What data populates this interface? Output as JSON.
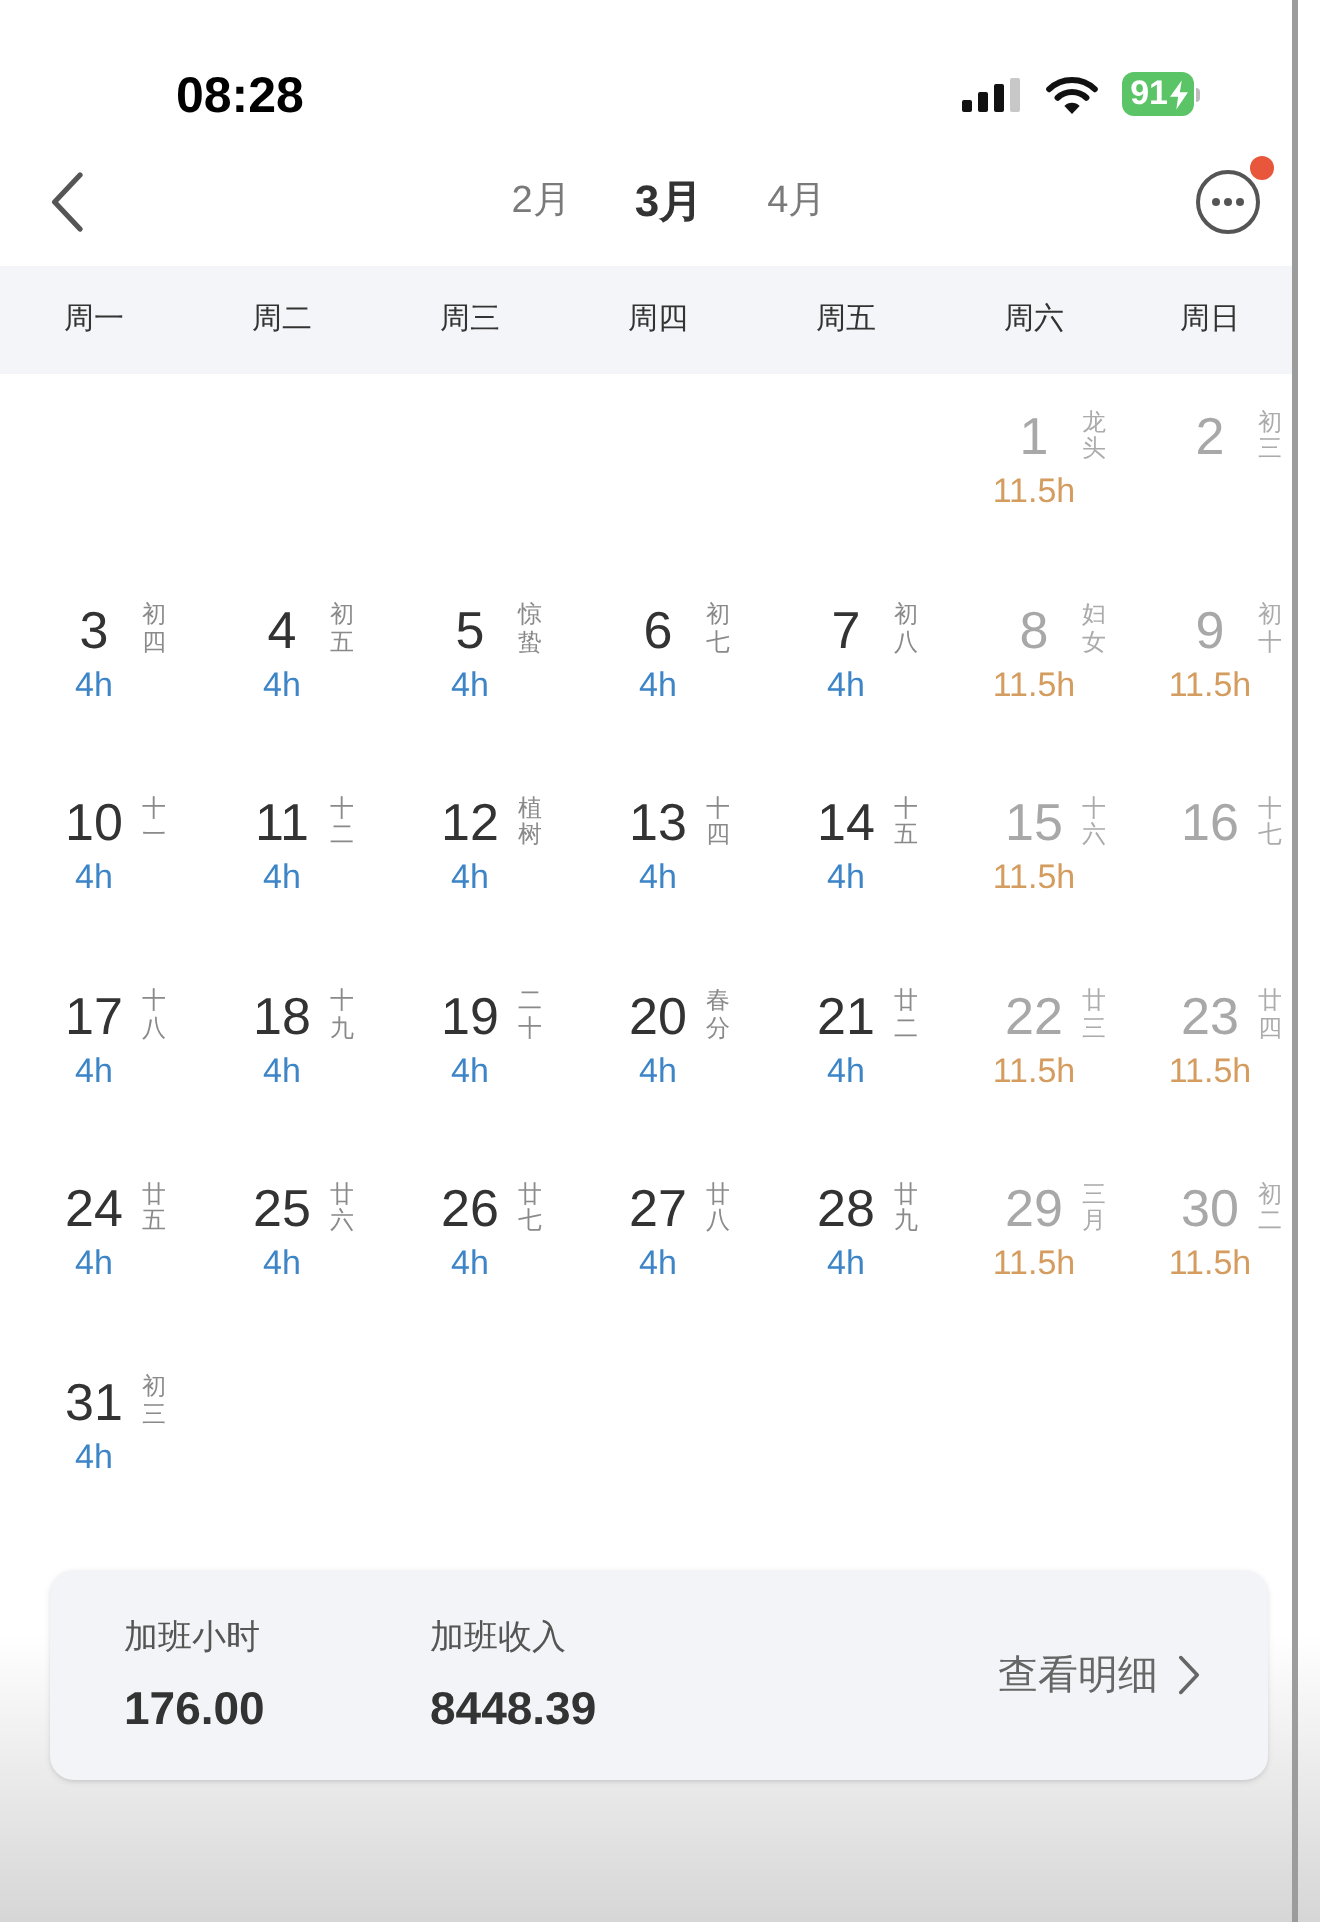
{
  "status_bar": {
    "time": "08:28",
    "battery": "91"
  },
  "nav": {
    "months": [
      {
        "label": "2月",
        "selected": false
      },
      {
        "label": "3月",
        "selected": true
      },
      {
        "label": "4月",
        "selected": false
      }
    ],
    "more": {
      "badge": true
    }
  },
  "calendar": {
    "weekdays": [
      "周一",
      "周二",
      "周三",
      "周四",
      "周五",
      "周六",
      "周日"
    ],
    "weeks": [
      {
        "days": [
          {
            "day": "1",
            "lunar": "龙头",
            "weekend": true,
            "hours": "11.5h",
            "color": "#d49c5e"
          },
          {
            "day": "2",
            "lunar": "初三",
            "weekend": true
          }
        ]
      },
      {
        "days": [
          {
            "day": "3",
            "lunar": "初四",
            "weekend": false,
            "hours": "4h",
            "color": "#3d85c6"
          },
          {
            "day": "4",
            "lunar": "初五",
            "weekend": false,
            "hours": "4h",
            "color": "#3d85c6"
          },
          {
            "day": "5",
            "lunar": "惊蛰",
            "weekend": false,
            "hours": "4h",
            "color": "#3d85c6"
          },
          {
            "day": "6",
            "lunar": "初七",
            "weekend": false,
            "hours": "4h",
            "color": "#3d85c6"
          },
          {
            "day": "7",
            "lunar": "初八",
            "weekend": false,
            "hours": "4h",
            "color": "#3d85c6"
          },
          {
            "day": "8",
            "lunar": "妇女",
            "weekend": true,
            "hours": "11.5h",
            "color": "#d49c5e"
          },
          {
            "day": "9",
            "lunar": "初十",
            "weekend": true,
            "hours": "11.5h",
            "color": "#d49c5e"
          }
        ]
      },
      {
        "days": [
          {
            "day": "10",
            "lunar": "十一",
            "weekend": false,
            "hours": "4h",
            "color": "#3d85c6"
          },
          {
            "day": "11",
            "lunar": "十二",
            "weekend": false,
            "hours": "4h",
            "color": "#3d85c6"
          },
          {
            "day": "12",
            "lunar": "植树",
            "weekend": false,
            "hours": "4h",
            "color": "#3d85c6"
          },
          {
            "day": "13",
            "lunar": "十四",
            "weekend": false,
            "hours": "4h",
            "color": "#3d85c6"
          },
          {
            "day": "14",
            "lunar": "十五",
            "weekend": false,
            "hours": "4h",
            "color": "#3d85c6"
          },
          {
            "day": "15",
            "lunar": "十六",
            "weekend": true,
            "hours": "11.5h",
            "color": "#d49c5e"
          },
          {
            "day": "16",
            "lunar": "十七",
            "weekend": true
          }
        ]
      },
      {
        "days": [
          {
            "day": "17",
            "lunar": "十八",
            "weekend": false,
            "hours": "4h",
            "color": "#3d85c6"
          },
          {
            "day": "18",
            "lunar": "十九",
            "weekend": false,
            "hours": "4h",
            "color": "#3d85c6"
          },
          {
            "day": "19",
            "lunar": "二十",
            "weekend": false,
            "hours": "4h",
            "color": "#3d85c6"
          },
          {
            "day": "20",
            "lunar": "春分",
            "weekend": false,
            "hours": "4h",
            "color": "#3d85c6"
          },
          {
            "day": "21",
            "lunar": "廿二",
            "weekend": false,
            "hours": "4h",
            "color": "#3d85c6"
          },
          {
            "day": "22",
            "lunar": "廿三",
            "weekend": true,
            "hours": "11.5h",
            "color": "#d49c5e"
          },
          {
            "day": "23",
            "lunar": "廿四",
            "weekend": true,
            "hours": "11.5h",
            "color": "#d49c5e"
          }
        ]
      },
      {
        "days": [
          {
            "day": "24",
            "lunar": "廿五",
            "weekend": false,
            "hours": "4h",
            "color": "#3d85c6"
          },
          {
            "day": "25",
            "lunar": "廿六",
            "weekend": false,
            "hours": "4h",
            "color": "#3d85c6"
          },
          {
            "day": "26",
            "lunar": "廿七",
            "weekend": false,
            "hours": "4h",
            "color": "#3d85c6"
          },
          {
            "day": "27",
            "lunar": "廿八",
            "weekend": false,
            "hours": "4h",
            "color": "#3d85c6"
          },
          {
            "day": "28",
            "lunar": "廿九",
            "weekend": false,
            "hours": "4h",
            "color": "#3d85c6"
          },
          {
            "day": "29",
            "lunar": "三月",
            "weekend": true,
            "hours": "11.5h",
            "color": "#d49c5e"
          },
          {
            "day": "30",
            "lunar": "初二",
            "weekend": true,
            "hours": "11.5h",
            "color": "#d49c5e"
          }
        ]
      },
      {
        "days": [
          {
            "day": "31",
            "lunar": "初三",
            "weekend": false,
            "hours": "4h",
            "color": "#3d85c6"
          }
        ]
      }
    ]
  },
  "summary": {
    "stats": [
      {
        "label": "加班小时",
        "value": "176.00"
      },
      {
        "label": "加班收入",
        "value": "8448.39"
      }
    ],
    "link": "查看明细"
  }
}
